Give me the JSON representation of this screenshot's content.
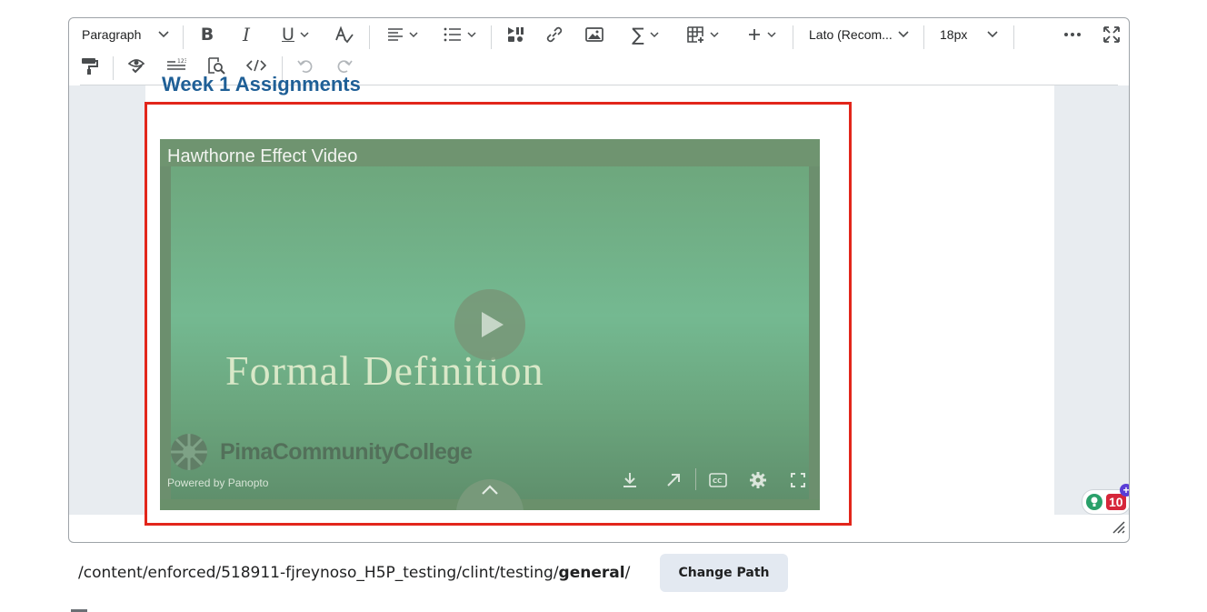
{
  "toolbar": {
    "paragraph_format": "Paragraph",
    "font_family": "Lato (Recom...",
    "font_size": "18px",
    "icons": [
      "bold-icon",
      "italic-icon",
      "underline-icon",
      "text-color-icon",
      "align-icon",
      "list-icon",
      "media-icon",
      "link-icon",
      "image-icon",
      "equation-icon",
      "table-icon",
      "insert-icon",
      "more-icon",
      "fullscreen-icon",
      "format-painter-icon",
      "accessibility-check-icon",
      "word-count-icon",
      "find-replace-icon",
      "source-code-icon",
      "undo-icon",
      "redo-icon"
    ]
  },
  "content": {
    "heading": "Week 1 Assignments",
    "video": {
      "title": "Hawthorne Effect Video",
      "slide_text": "Formal Definition",
      "logo_text": "PimaCommunityCollege",
      "powered_by": "Powered by Panopto"
    }
  },
  "assistant_badge": {
    "count": "10",
    "plus": "+"
  },
  "footer": {
    "path_prefix": "/content/enforced/518911-fjreynoso_H5P_testing/clint/testing/",
    "path_bold": "general",
    "path_suffix": "/",
    "change_path_label": "Change Path"
  },
  "colors": {
    "selection_border": "#e2261b",
    "heading": "#1f5f96",
    "button_bg": "#e3e9f1"
  }
}
